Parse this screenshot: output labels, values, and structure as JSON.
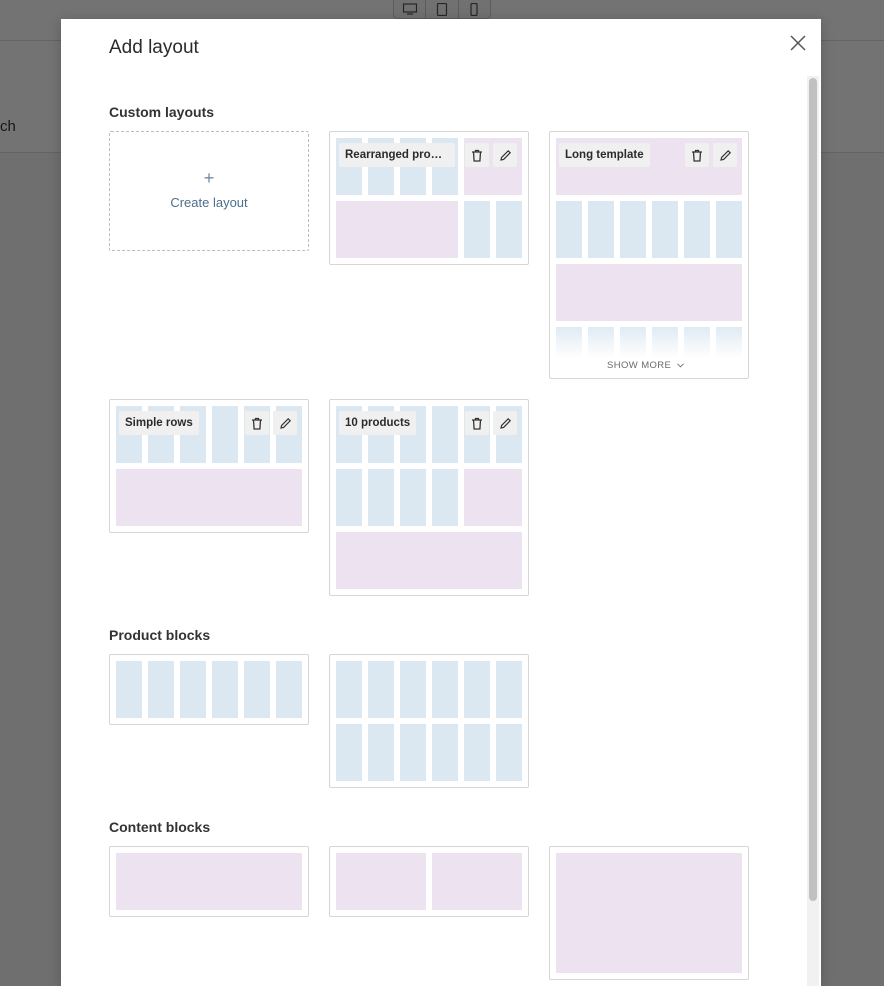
{
  "background": {
    "partial_text": "ch",
    "device_icons": [
      "desktop-icon",
      "tablet-icon",
      "phone-icon"
    ]
  },
  "modal": {
    "title": "Add layout",
    "close_icon": "close-icon"
  },
  "sections": {
    "custom": {
      "title": "Custom layouts",
      "create_label": "Create layout",
      "create_plus": "+",
      "layouts": [
        {
          "name": "Rearranged produ..."
        },
        {
          "name": "Long template",
          "show_more": "SHOW MORE"
        },
        {
          "name": "Simple rows"
        },
        {
          "name": "10 products"
        }
      ]
    },
    "product": {
      "title": "Product blocks"
    },
    "content": {
      "title": "Content blocks"
    }
  },
  "colors": {
    "product_block": "#dbe8f2",
    "content_block": "#ede2ef",
    "link": "#4d6e8c"
  }
}
